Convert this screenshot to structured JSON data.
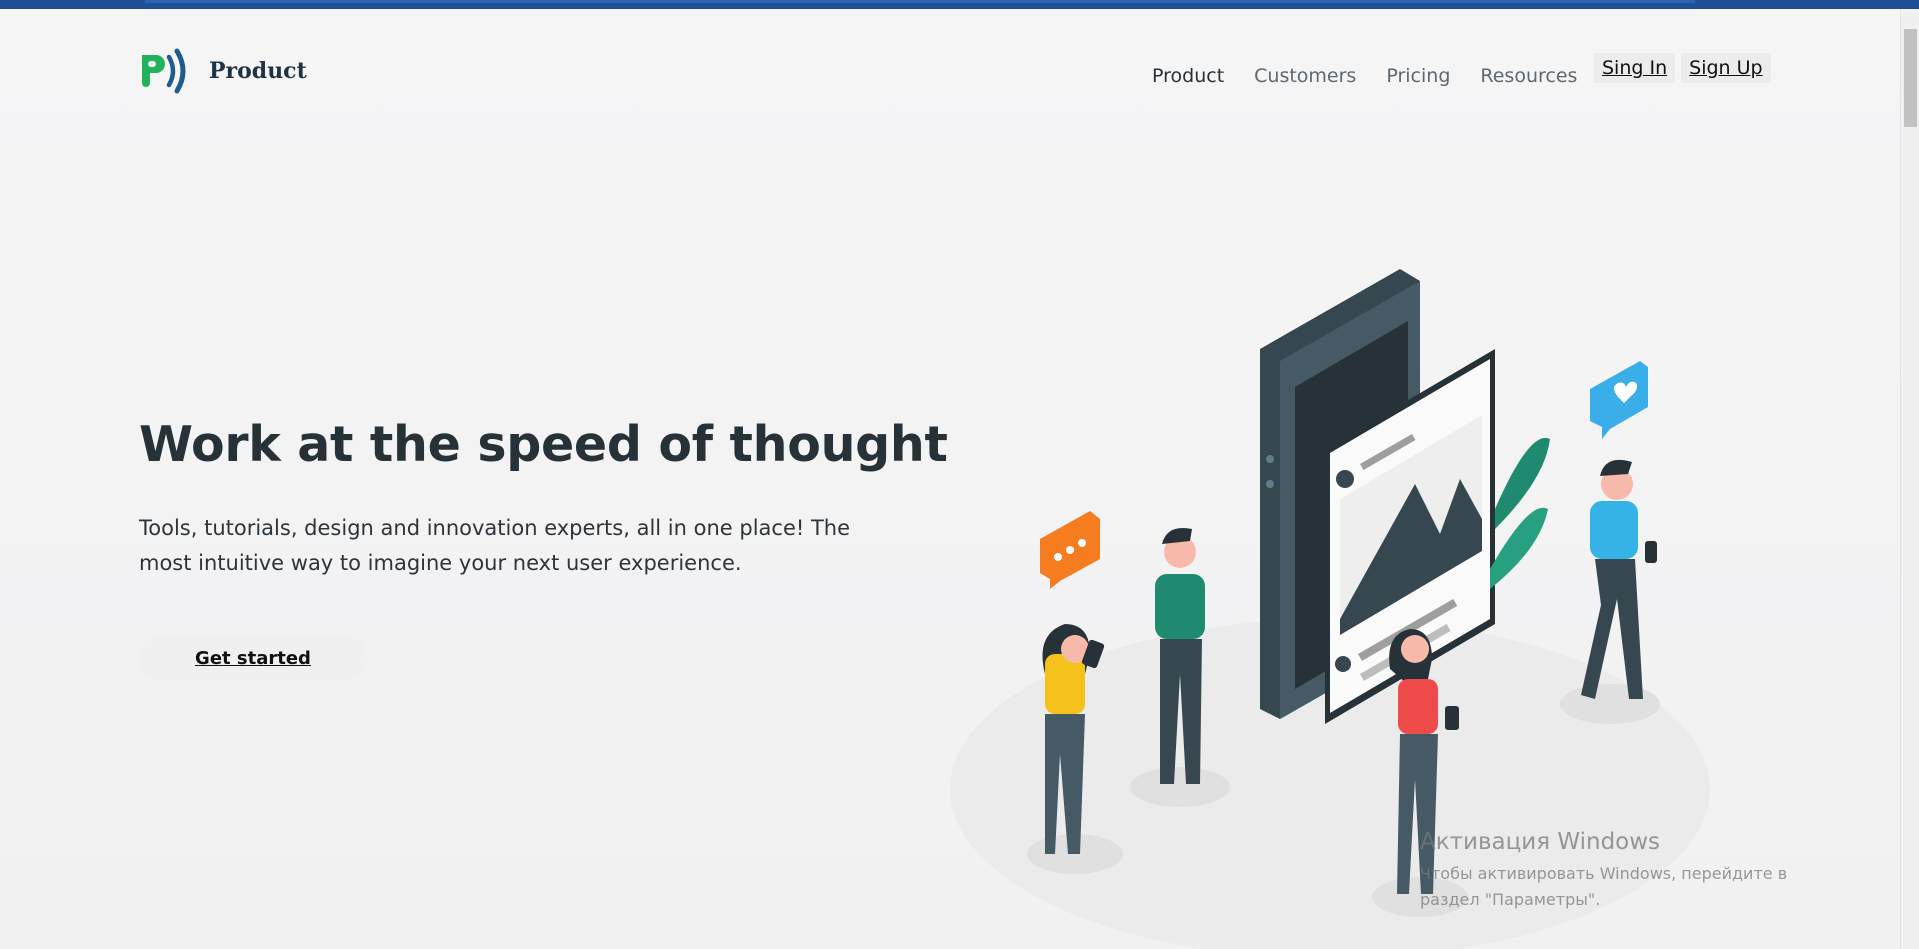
{
  "brand": {
    "name": "Product"
  },
  "nav": {
    "items": [
      {
        "label": "Product",
        "active": true
      },
      {
        "label": "Customers",
        "active": false
      },
      {
        "label": "Pricing",
        "active": false
      },
      {
        "label": "Resources",
        "active": false
      }
    ],
    "sign_in": "Sing In",
    "sign_up": "Sign Up"
  },
  "hero": {
    "title": "Work at the speed of thought",
    "subtitle": "Tools, tutorials, design and innovation experts, all in one place! The most intuitive way to imagine your next user experience.",
    "cta_label": "Get started"
  },
  "watermark": {
    "title": "Активация Windows",
    "text": "Чтобы активировать Windows, перейдите в раздел \"Параметры\"."
  },
  "colors": {
    "accent_green": "#20b35b",
    "accent_dark": "#1f3345",
    "top_band": "#1e4f95",
    "shirt_green": "#1f8a6f",
    "shirt_yellow": "#f4c21b",
    "shirt_red": "#ef4b4b",
    "shirt_blue": "#35b3e6",
    "bubble_orange": "#f57c1f",
    "bubble_blue": "#39aee8"
  }
}
